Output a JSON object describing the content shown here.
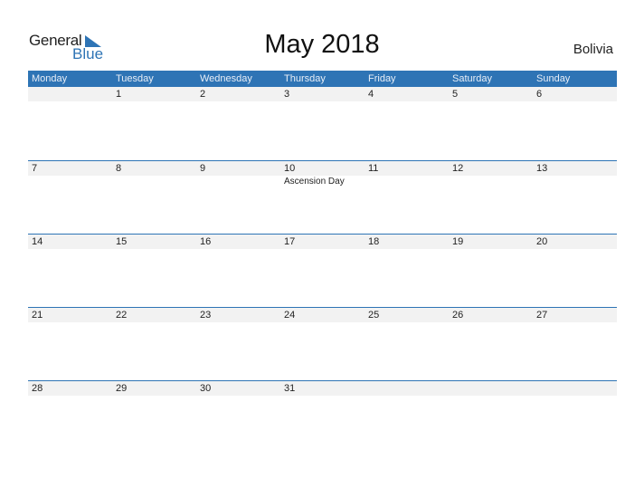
{
  "logo": {
    "general": "General",
    "blue": "Blue"
  },
  "title": "May 2018",
  "country": "Bolivia",
  "weekdays": [
    "Monday",
    "Tuesday",
    "Wednesday",
    "Thursday",
    "Friday",
    "Saturday",
    "Sunday"
  ],
  "weeks": [
    {
      "days": [
        "",
        "1",
        "2",
        "3",
        "4",
        "5",
        "6"
      ],
      "events": [
        "",
        "",
        "",
        "",
        "",
        "",
        ""
      ]
    },
    {
      "days": [
        "7",
        "8",
        "9",
        "10",
        "11",
        "12",
        "13"
      ],
      "events": [
        "",
        "",
        "",
        "Ascension Day",
        "",
        "",
        ""
      ]
    },
    {
      "days": [
        "14",
        "15",
        "16",
        "17",
        "18",
        "19",
        "20"
      ],
      "events": [
        "",
        "",
        "",
        "",
        "",
        "",
        ""
      ]
    },
    {
      "days": [
        "21",
        "22",
        "23",
        "24",
        "25",
        "26",
        "27"
      ],
      "events": [
        "",
        "",
        "",
        "",
        "",
        "",
        ""
      ]
    },
    {
      "days": [
        "28",
        "29",
        "30",
        "31",
        "",
        "",
        ""
      ],
      "events": [
        "",
        "",
        "",
        "",
        "",
        "",
        ""
      ]
    }
  ],
  "colors": {
    "accent": "#2e74b5",
    "day_strip": "#f2f2f2"
  }
}
